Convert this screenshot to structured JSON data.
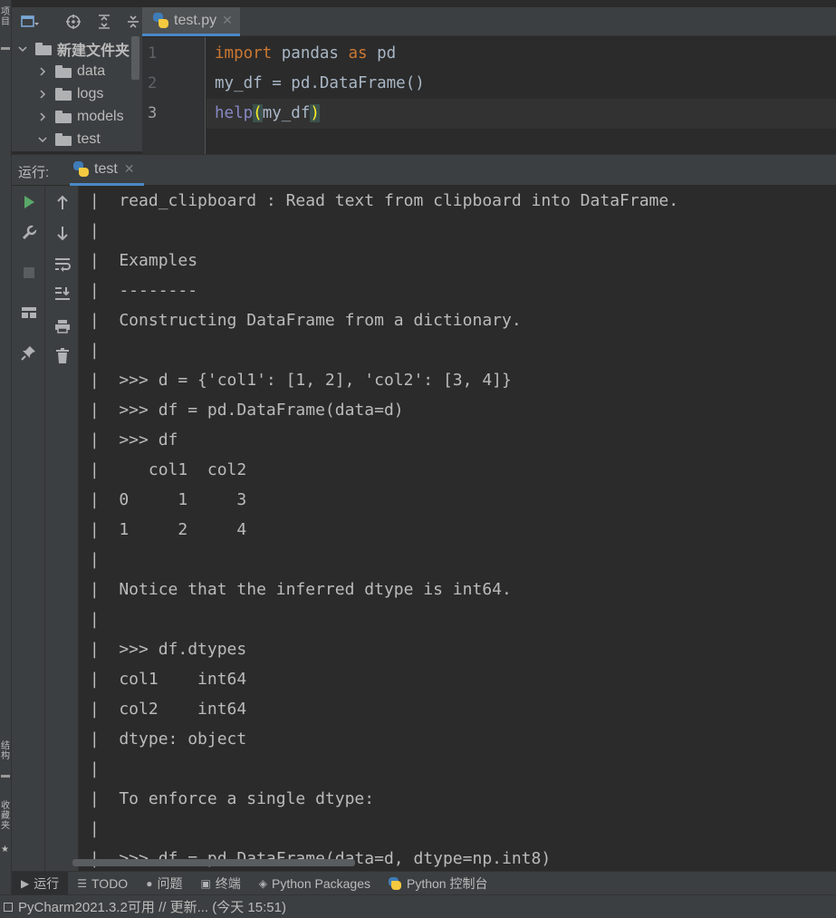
{
  "left_strip": {
    "labels": [
      "项目",
      "结构",
      "收藏夹"
    ]
  },
  "project": {
    "tree": [
      {
        "label": "新建文件夹",
        "expanded": true,
        "depth": 0
      },
      {
        "label": "data",
        "expanded": false,
        "depth": 1
      },
      {
        "label": "logs",
        "expanded": false,
        "depth": 1
      },
      {
        "label": "models",
        "expanded": false,
        "depth": 1
      },
      {
        "label": "test",
        "expanded": true,
        "depth": 1
      }
    ]
  },
  "editor": {
    "tab_label": "test.py",
    "line_numbers": [
      "1",
      "2",
      "3"
    ],
    "current_line": 3,
    "code": {
      "l1_kw1": "import",
      "l1_mod": " pandas ",
      "l1_kw2": "as",
      "l1_alias": " pd",
      "l2": "my_df = pd.DataFrame()",
      "l3_fn": "help",
      "l3_open": "(",
      "l3_arg": "my_df",
      "l3_close": ")"
    }
  },
  "run": {
    "label": "运行:",
    "tab_label": "test",
    "console_lines": [
      " |  read_clipboard : Read text from clipboard into DataFrame.",
      " |",
      " |  Examples",
      " |  --------",
      " |  Constructing DataFrame from a dictionary.",
      " |",
      " |  >>> d = {'col1': [1, 2], 'col2': [3, 4]}",
      " |  >>> df = pd.DataFrame(data=d)",
      " |  >>> df",
      " |     col1  col2",
      " |  0     1     3",
      " |  1     2     4",
      " |",
      " |  Notice that the inferred dtype is int64.",
      " |",
      " |  >>> df.dtypes",
      " |  col1    int64",
      " |  col2    int64",
      " |  dtype: object",
      " |",
      " |  To enforce a single dtype:",
      " |",
      " |  >>> df = pd.DataFrame(data=d, dtype=np.int8)"
    ]
  },
  "tool_windows": [
    {
      "label": "运行",
      "icon": "play-icon",
      "active": true
    },
    {
      "label": "TODO",
      "icon": "list-icon",
      "active": false
    },
    {
      "label": "问题",
      "icon": "info-icon",
      "active": false
    },
    {
      "label": "终端",
      "icon": "terminal-icon",
      "active": false
    },
    {
      "label": "Python Packages",
      "icon": "packages-icon",
      "active": false
    },
    {
      "label": "Python 控制台",
      "icon": "python-console-icon",
      "active": false
    }
  ],
  "status": {
    "message": "PyCharm2021.3.2可用 // 更新... (今天 15:51)"
  },
  "colors": {
    "keyword": "#cc7832",
    "builtin": "#8888c6",
    "bracket_match": "#ffef28",
    "run_green": "#59a869",
    "accent": "#4a88c7"
  }
}
